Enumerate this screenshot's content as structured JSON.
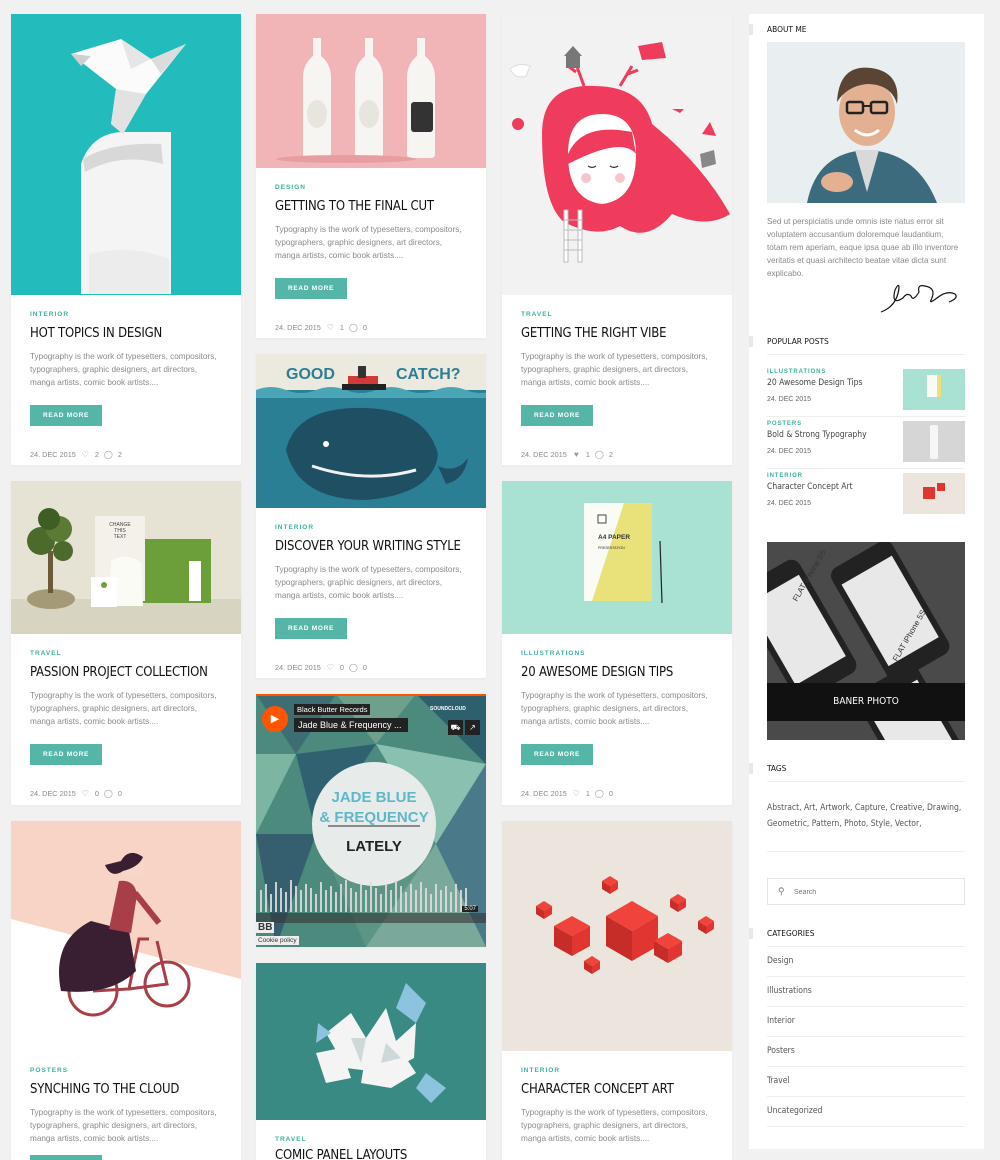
{
  "posts": {
    "hot_topics": {
      "category": "INTERIOR",
      "title": "HOT TOPICS IN DESIGN",
      "excerpt": "Typography is the work of typesetters, compositors, typographers, graphic designers, art directors, manga artists, comic book artists....",
      "button": "READ MORE",
      "date": "24. DEC 2015",
      "likes": "2",
      "comments": "2"
    },
    "final_cut": {
      "category": "DESIGN",
      "title": "GETTING TO THE FINAL CUT",
      "excerpt": "Typography is the work of typesetters, compositors, typographers, graphic designers, art directors, manga artists, comic book artists....",
      "button": "READ MORE",
      "date": "24. DEC 2015",
      "likes": "1",
      "comments": "0"
    },
    "right_vibe": {
      "category": "TRAVEL",
      "title": "GETTING THE RIGHT VIBE",
      "excerpt": "Typography is the work of typesetters, compositors, typographers, graphic designers, art directors, manga artists, comic book artists....",
      "button": "READ MORE",
      "date": "24. DEC 2015",
      "likes": "1",
      "comments": "2"
    },
    "writing_style": {
      "category": "INTERIOR",
      "title": "DISCOVER YOUR WRITING STYLE",
      "excerpt": "Typography is the work of typesetters, compositors, typographers, graphic designers, art directors, manga artists, comic book artists....",
      "button": "READ MORE",
      "date": "24. DEC 2015",
      "likes": "0",
      "comments": "0",
      "image_text_left": "GOOD",
      "image_text_right": "CATCH?"
    },
    "passion_project": {
      "category": "TRAVEL",
      "title": "PASSION PROJECT COLLECTION",
      "excerpt": "Typography is the work of typesetters, compositors, typographers, graphic designers, art directors, manga artists, comic book artists....",
      "button": "READ MORE",
      "date": "24. DEC 2015",
      "likes": "0",
      "comments": "0",
      "image_text": "CHANGE THIS TEXT"
    },
    "awesome_tips": {
      "category": "ILLUSTRATIONS",
      "title": "20 AWESOME DESIGN TIPS",
      "excerpt": "Typography is the work of typesetters, compositors, typographers, graphic designers, art directors, manga artists, comic book artists....",
      "button": "READ MORE",
      "date": "24. DEC 2015",
      "likes": "1",
      "comments": "0",
      "paper_title": "A4 PAPER",
      "paper_sub": "PRESENTATION"
    },
    "soundcloud": {
      "label": "Black Butter Records",
      "track": "Jade Blue & Frequency ...",
      "brand": "SOUNDCLOUD",
      "art_line1": "JADE BLUE",
      "art_line2": "& FREQUENCY",
      "art_line3": "LATELY",
      "time": "5:07",
      "cookie": "Cookie policy",
      "bb": "BB"
    },
    "synching": {
      "category": "POSTERS",
      "title": "SYNCHING TO THE CLOUD",
      "excerpt": "Typography is the work of typesetters, compositors, typographers, graphic designers, art directors, manga artists, comic book artists...."
    },
    "comic_panel": {
      "category": "TRAVEL",
      "title": "COMIC PANEL LAYOUTS"
    },
    "character": {
      "category": "INTERIOR",
      "title": "CHARACTER CONCEPT ART",
      "excerpt": "Typography is the work of typesetters, compositors, typographers, graphic designers, art directors, manga artists, comic book artists...."
    }
  },
  "sidebar": {
    "about_heading": "ABOUT ME",
    "about_text": "Sed ut perspiciatis unde omnis iste natus error sit voluptatem accusantium doloremque laudantium, totam rem aperiam, eaque ipsa quae ab illo inventore veritatis et quasi architecto beatae vitae dicta sunt explicabo.",
    "popular_heading": "POPULAR POSTS",
    "popular": [
      {
        "category": "ILLUSTRATIONS",
        "title": "20 Awesome Design Tips",
        "date": "24. DEC 2015"
      },
      {
        "category": "POSTERS",
        "title": "Bold & Strong Typography",
        "date": "24. DEC 2015"
      },
      {
        "category": "INTERIOR",
        "title": "Character Concept Art",
        "date": "24. DEC 2015"
      }
    ],
    "banner": "BANER PHOTO",
    "banner_phone1": "FLAT iPhone 5S",
    "banner_phone2": "FLAT iPhone 5S",
    "tags_heading": "TAGS",
    "tags": "Abstract, Art, Artwork, Capture, Creative, Drawing, Geometric, Pattern, Photo, Style, Vector,",
    "search_placeholder": "Search",
    "categories_heading": "CATEGORIES",
    "categories": [
      "Design",
      "Illustrations",
      "Interior",
      "Posters",
      "Travel",
      "Uncategorized"
    ]
  },
  "colors": {
    "accent": "#55b6a7",
    "category": "#3cb3a0"
  }
}
